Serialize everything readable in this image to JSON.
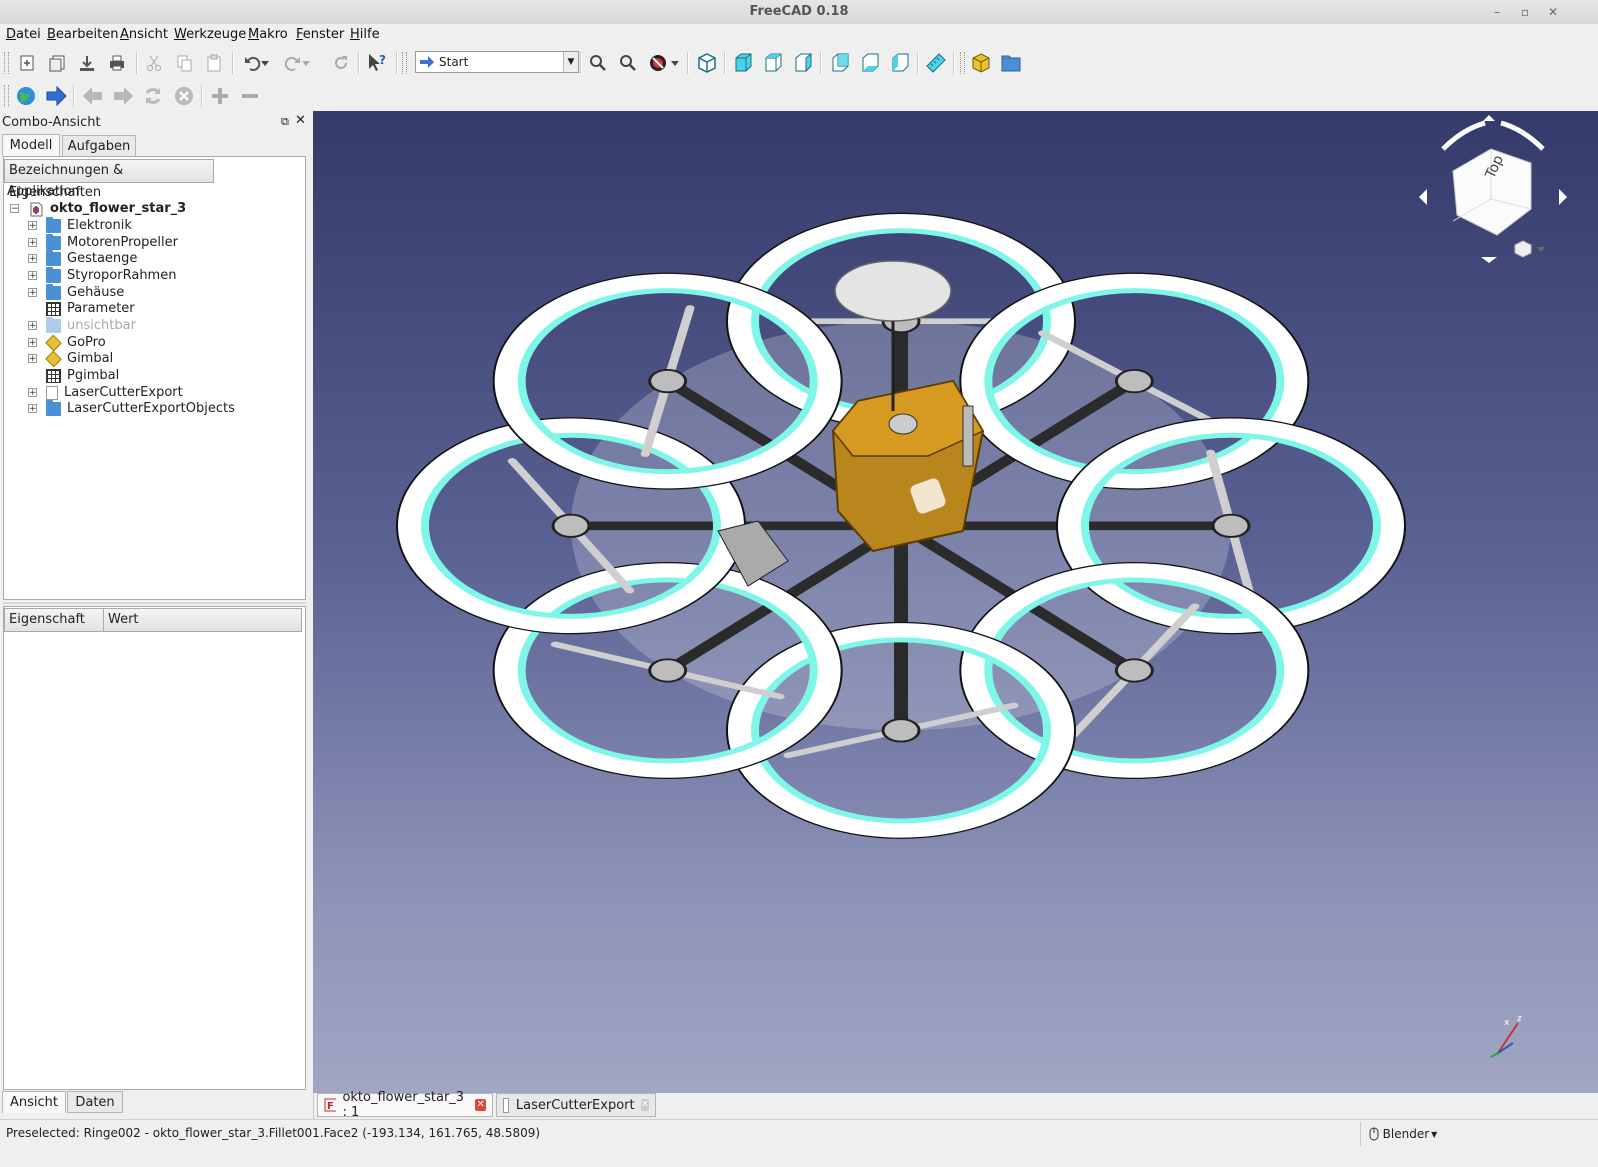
{
  "window": {
    "title": "FreeCAD 0.18"
  },
  "menu": [
    "Datei",
    "Bearbeiten",
    "Ansicht",
    "Werkzeuge",
    "Makro",
    "Fenster",
    "Hilfe"
  ],
  "toolbar": {
    "workbench": "Start"
  },
  "combo_view": {
    "title": "Combo-Ansicht",
    "tabs": [
      "Modell",
      "Aufgaben"
    ],
    "tree_header": "Bezeichnungen & Eigenschaften",
    "root_label": "Applikation",
    "document": "okto_flower_star_3",
    "items": [
      {
        "label": "Elektronik",
        "icon": "folder-icon"
      },
      {
        "label": "MotorenPropeller",
        "icon": "folder-icon"
      },
      {
        "label": "Gestaenge",
        "icon": "folder-icon"
      },
      {
        "label": "StyroporRahmen",
        "icon": "folder-icon"
      },
      {
        "label": "Gehäuse",
        "icon": "folder-icon"
      },
      {
        "label": "Parameter",
        "icon": "spreadsheet-icon"
      },
      {
        "label": "unsichtbar",
        "icon": "folder-icon"
      },
      {
        "label": "GoPro",
        "icon": "part-icon"
      },
      {
        "label": "Gimbal",
        "icon": "part-icon"
      },
      {
        "label": "Pgimbal",
        "icon": "spreadsheet-icon"
      },
      {
        "label": "LaserCutterExport",
        "icon": "document-icon"
      },
      {
        "label": "LaserCutterExportObjects",
        "icon": "folder-icon"
      }
    ],
    "property_headers": [
      "Eigenschaft",
      "Wert"
    ],
    "bottom_tabs": [
      "Ansicht",
      "Daten"
    ]
  },
  "navcube": {
    "face": "Top"
  },
  "doc_tabs": [
    "okto_flower_star_3 : 1",
    "LaserCutterExport"
  ],
  "status": {
    "message": "Preselected: Ringe002 - okto_flower_star_3.Fillet001.Face2 (-193.134, 161.765, 48.5809)",
    "nav_style": "Blender"
  },
  "colors": {
    "view_top": "#343a6a",
    "view_bottom": "#a2a6c4",
    "ring_glow": "#7ff7e8",
    "body": "#b8861c"
  }
}
